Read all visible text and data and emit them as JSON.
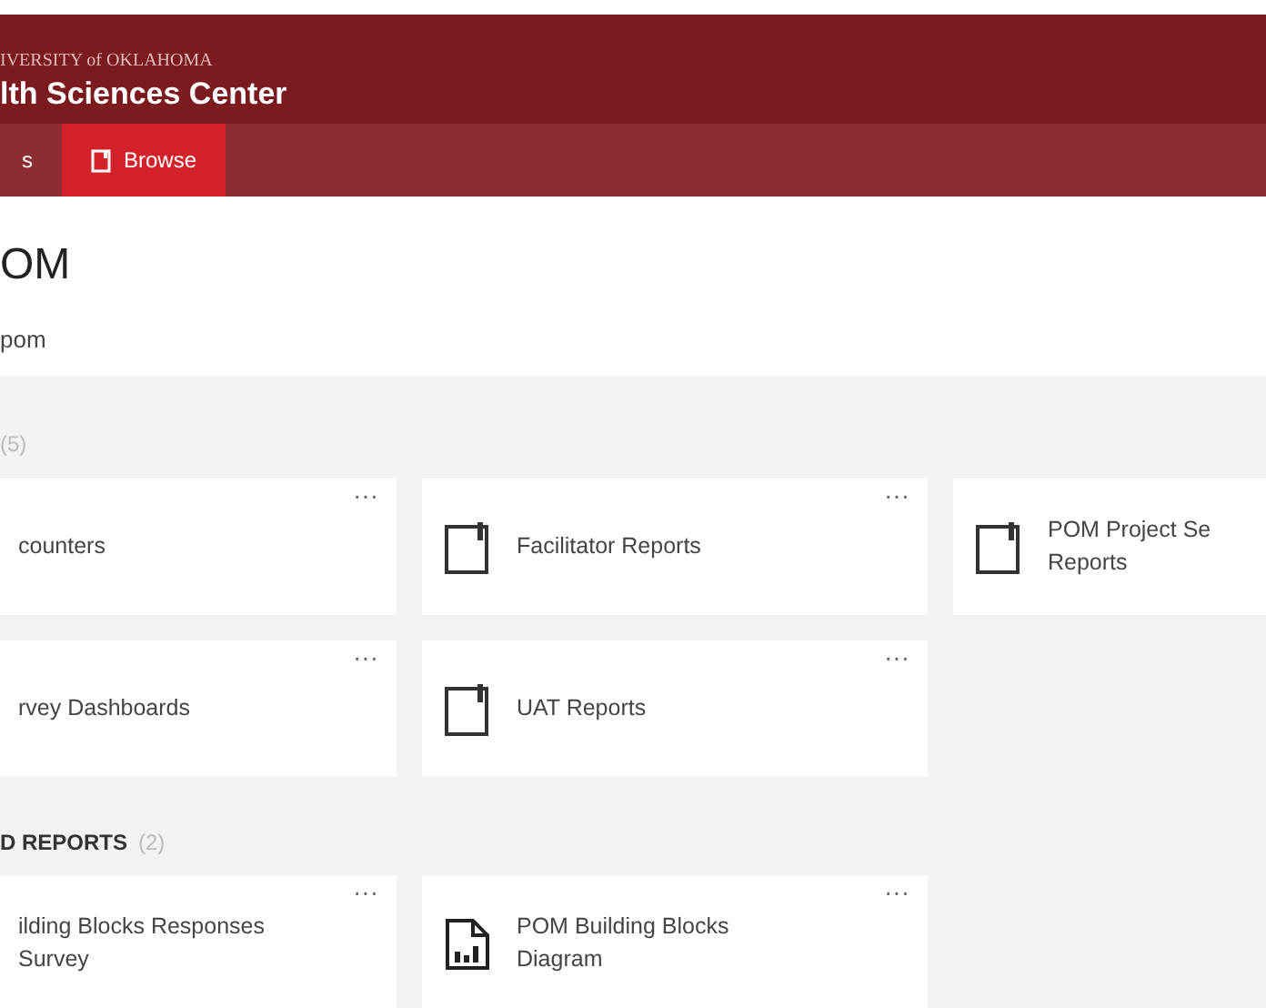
{
  "header": {
    "org_line": "IVERSITY of OKLAHOMA",
    "name": "lth Sciences Center"
  },
  "nav_tabs": [
    {
      "label": "s",
      "selected": false,
      "kind": "plain"
    },
    {
      "label": "Browse",
      "selected": true,
      "kind": "document"
    }
  ],
  "page": {
    "title": "OM",
    "subtitle": "pom"
  },
  "sections": [
    {
      "count": "(5)",
      "tiles": [
        {
          "lines": [
            "counters"
          ],
          "kind": "plain",
          "more": "···"
        },
        {
          "lines": [
            "Facilitator Reports"
          ],
          "kind": "document",
          "more": "···"
        },
        {
          "lines": [
            "POM Project Se",
            "Reports"
          ],
          "kind": "document"
        },
        {
          "lines": [
            "rvey Dashboards"
          ],
          "kind": "plain",
          "more": "···"
        },
        {
          "lines": [
            "UAT Reports"
          ],
          "kind": "document",
          "more": "···"
        }
      ]
    },
    {
      "heading": "D REPORTS",
      "count": "(2)",
      "tiles": [
        {
          "lines": [
            "ilding Blocks Responses",
            "Survey"
          ],
          "kind": "plain",
          "more": "···"
        },
        {
          "lines": [
            "POM Building Blocks",
            "Diagram"
          ],
          "kind": "chart",
          "more": "···"
        }
      ]
    }
  ]
}
